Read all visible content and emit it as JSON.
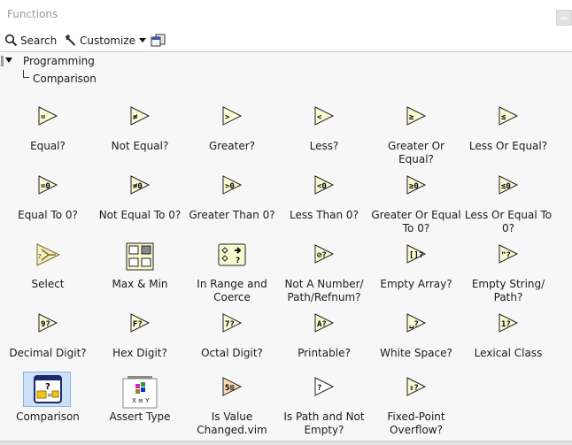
{
  "window": {
    "title": "Functions"
  },
  "toolbar": {
    "search_label": "Search",
    "customize_label": "Customize",
    "icons": {
      "search": "magnifier-icon",
      "customize": "wrench-icon",
      "window": "new-window-icon"
    }
  },
  "tree": {
    "root": "Programming",
    "child": "Comparison"
  },
  "palette": {
    "items": [
      {
        "label": "Equal?",
        "glyph": "=",
        "kind": "tri"
      },
      {
        "label": "Not Equal?",
        "glyph": "≠",
        "kind": "tri"
      },
      {
        "label": "Greater?",
        "glyph": ">",
        "kind": "tri"
      },
      {
        "label": "Less?",
        "glyph": "<",
        "kind": "tri"
      },
      {
        "label": "Greater Or Equal?",
        "glyph": "≥",
        "kind": "tri"
      },
      {
        "label": "Less Or Equal?",
        "glyph": "≤",
        "kind": "tri"
      },
      {
        "label": "Equal To 0?",
        "glyph": "=0",
        "kind": "tri"
      },
      {
        "label": "Not Equal To 0?",
        "glyph": "≠0",
        "kind": "tri"
      },
      {
        "label": "Greater Than 0?",
        "glyph": ">0",
        "kind": "tri"
      },
      {
        "label": "Less Than 0?",
        "glyph": "<0",
        "kind": "tri"
      },
      {
        "label": "Greater Or Equal To 0?",
        "glyph": "≥0",
        "kind": "tri"
      },
      {
        "label": "Less Or Equal To 0?",
        "glyph": "≤0",
        "kind": "tri"
      },
      {
        "label": "Select",
        "glyph": "?",
        "kind": "select"
      },
      {
        "label": "Max & Min",
        "glyph": "",
        "kind": "maxmin"
      },
      {
        "label": "In Range and Coerce",
        "glyph": "",
        "kind": "range"
      },
      {
        "label": "Not A Number/ Path/Refnum?",
        "glyph": "⊘?",
        "kind": "tri"
      },
      {
        "label": "Empty Array?",
        "glyph": "[]?",
        "kind": "tri"
      },
      {
        "label": "Empty String/ Path?",
        "glyph": "\"?",
        "kind": "tri"
      },
      {
        "label": "Decimal Digit?",
        "glyph": "9?",
        "kind": "tri"
      },
      {
        "label": "Hex Digit?",
        "glyph": "F?",
        "kind": "tri"
      },
      {
        "label": "Octal Digit?",
        "glyph": "7?",
        "kind": "tri"
      },
      {
        "label": "Printable?",
        "glyph": "A?",
        "kind": "tri"
      },
      {
        "label": "White Space?",
        "glyph": "␣?",
        "kind": "tri"
      },
      {
        "label": "Lexical Class",
        "glyph": "1?",
        "kind": "tri"
      },
      {
        "label": "Comparison",
        "glyph": "?",
        "kind": "subpalette",
        "selected": true
      },
      {
        "label": "Assert Type",
        "glyph": "X ≡ Y",
        "kind": "assert"
      },
      {
        "label": "Is Value Changed.vim",
        "glyph": "5≡",
        "kind": "vim"
      },
      {
        "label": "Is Path and Not Empty?",
        "glyph": "?",
        "kind": "tri-white"
      },
      {
        "label": "Fixed-Point Overflow?",
        "glyph": "⇕?",
        "kind": "tri"
      }
    ]
  }
}
